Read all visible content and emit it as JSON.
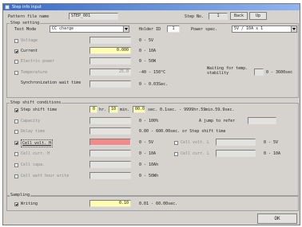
{
  "window": {
    "title": "Step info input"
  },
  "header": {
    "pattern_label": "Pattern file name",
    "pattern_value": "STEP_001",
    "step_no_label": "Step No.",
    "step_no_value": "1",
    "back_label": "Back",
    "up_label": "Up"
  },
  "step_setting": {
    "group_label": "Step setting",
    "test_mode_label": "Test Mode",
    "test_mode_value": "CC charge",
    "holder_label": "Holder ID",
    "holder_value": "1",
    "power_label": "Power spec.",
    "power_value": "5V / 10A x 1",
    "voltage_label": "Voltage",
    "voltage_range": "0 - 5V",
    "current_label": "Current",
    "current_value": "0.000",
    "current_range": "0 - 10A",
    "electric_label": "Electric power",
    "electric_range": "0 - 50W",
    "temperature_label": "Temperature",
    "temperature_value": "25.0",
    "temperature_range": "-40 - 150°C",
    "waiting_label": "Waiting for temp. stability",
    "waiting_range": "0 - 3600sec",
    "sync_label": "Synchronization wait time",
    "sync_range": "0 - 0.03Sec."
  },
  "step_shift": {
    "group_label": "Step shift conditions",
    "step_shift_label": "Step shift time",
    "hr_value": "0",
    "hr_unit": "hr.",
    "min_value": "10",
    "min_unit": "min.",
    "sec_value": "00.0",
    "sec_unit": "sec. 0.1sec. - 9999hr.59min.59.9sec.",
    "capacity_label": "Capacity",
    "capacity_range": "0 - 100%",
    "jump_label": "A jump to refer",
    "delay_label": "Delay time",
    "delay_range": "0.00 - 600.00sec. or Step shift time",
    "cellv_h_label": "Cell volt. H",
    "cellv_h_range": "0 - 5V",
    "cellv_l_label": "Cell volt. L",
    "cellv_l_range": "0 - 5V",
    "cellc_h_label": "Cell curr. H",
    "cellc_h_range": "0 - 10A",
    "cellc_l_label": "Cell curr. L",
    "cellc_l_range": "0 - 10A",
    "cellcap_label": "Cell capa.",
    "cellcap_range": "0 - 10Ah",
    "cellwatt_label": "Cell watt hour write",
    "cellwatt_range": "0 - 50Wh"
  },
  "sampling": {
    "group_label": "Sampling",
    "writing_label": "Writing",
    "writing_value": "0.10",
    "writing_range": "0.01 - 60.00sec."
  },
  "footer": {
    "ok_label": "OK"
  },
  "colors": {
    "accent": "#3a6cc8",
    "yellow_field": "#ffffb0",
    "red_field": "#f28a8a",
    "window_bg": "#d6d3ce"
  }
}
